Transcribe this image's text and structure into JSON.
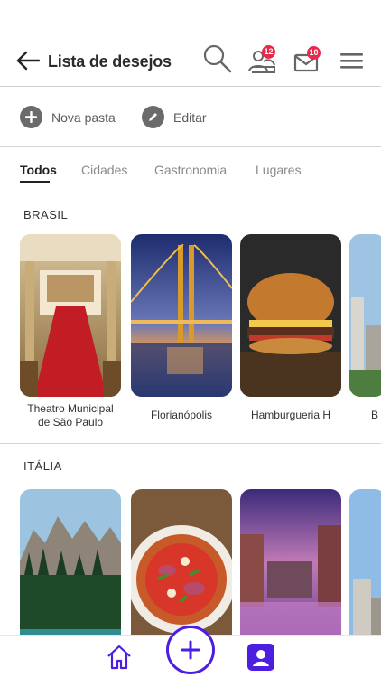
{
  "header": {
    "title": "Lista de desejos",
    "back_icon": "back-arrow-icon",
    "search_icon": "search-icon",
    "users_badge": "12",
    "mail_badge": "10",
    "menu_icon": "menu-icon",
    "badge_color": "#e8294a"
  },
  "actions": {
    "new_folder": "Nova pasta",
    "edit": "Editar"
  },
  "tabs": [
    "Todos",
    "Cidades",
    "Gastronomia",
    "Lugares"
  ],
  "sections": [
    {
      "title": "BRASIL",
      "items": [
        {
          "line1": "Theatro Municipal",
          "line2": "de São Paulo"
        },
        {
          "line1": "Florianópolis",
          "line2": ""
        },
        {
          "line1": "Hamburgueria H",
          "line2": ""
        },
        {
          "line1": "B",
          "line2": ""
        }
      ]
    },
    {
      "title": "ITÁLIA",
      "items": []
    }
  ],
  "bottom_nav": {
    "home_icon": "home-icon",
    "add_icon": "plus-icon",
    "profile_icon": "profile-icon",
    "accent_color": "#4b1ee0"
  }
}
